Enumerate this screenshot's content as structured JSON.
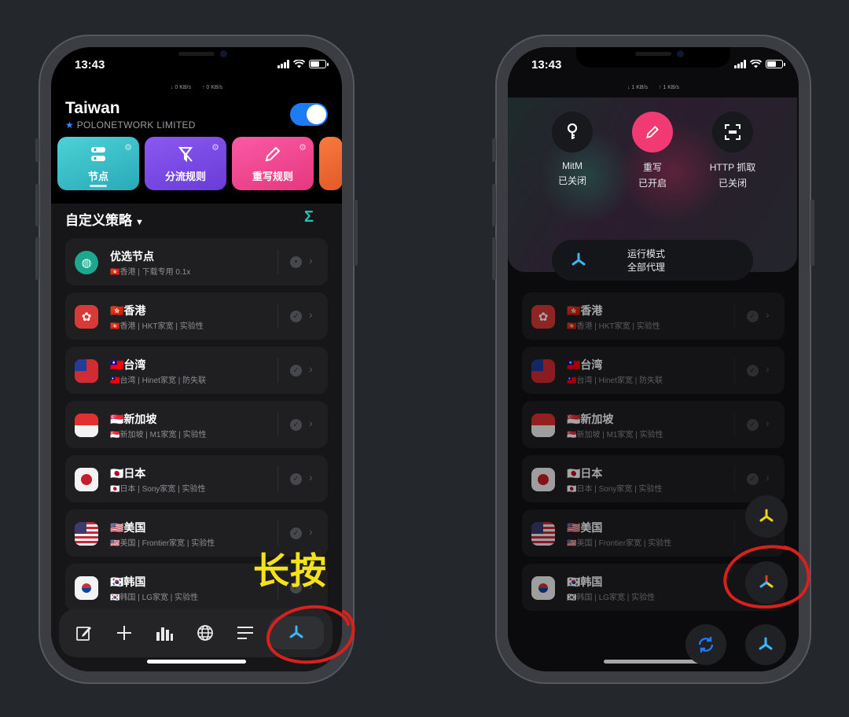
{
  "status": {
    "time": "13:43"
  },
  "left": {
    "speeds": {
      "down": "↓ 0 KB/s",
      "up": "↑ 0 KB/s"
    },
    "header": {
      "country": "Taiwan",
      "provider": "POLONETWORK LIMITED",
      "provider_icon": "star-icon",
      "vpn_on": true
    },
    "tiles": [
      {
        "label": "节点",
        "icon": "server-icon",
        "color": "#3cc0c8"
      },
      {
        "label": "分流规则",
        "icon": "split-icon",
        "color": "#7a4ae6"
      },
      {
        "label": "重写规则",
        "icon": "pencil-icon",
        "color": "#f04891"
      }
    ],
    "policy_title": "自定义策略",
    "nodes": [
      {
        "name": "优选节点",
        "sub": "🇭🇰香港 | 下载专用 0.1x"
      },
      {
        "name": "🇭🇰香港",
        "sub": "🇭🇰香港 | HKT家宽 | 实验性"
      },
      {
        "name": "🇹🇼台湾",
        "sub": "🇹🇼台湾 | Hinet家宽 | 防失联"
      },
      {
        "name": "🇸🇬新加坡",
        "sub": "🇸🇬新加坡 | M1家宽 | 实验性"
      },
      {
        "name": "🇯🇵日本",
        "sub": "🇯🇵日本 | Sony家宽 | 实验性"
      },
      {
        "name": "🇺🇸美国",
        "sub": "🇺🇸美国 | Frontier家宽 | 实验性"
      },
      {
        "name": "🇰🇷韩国",
        "sub": "🇰🇷韩国 | LG家宽 | 实验性"
      }
    ],
    "tabbar": [
      "edit-icon",
      "plus-icon",
      "stats-icon",
      "globe-icon",
      "menu-icon",
      "fan-icon"
    ],
    "annotation": "长按"
  },
  "right": {
    "speeds": {
      "down": "↓ 1 KB/s",
      "up": "↑ 1 KB/s"
    },
    "controls": [
      {
        "name": "MitM",
        "state": "已关闭",
        "icon": "key-icon"
      },
      {
        "name": "重写",
        "state": "已开启",
        "icon": "pencil-icon"
      },
      {
        "name": "HTTP 抓取",
        "state": "已关闭",
        "icon": "http-capture-icon"
      }
    ],
    "mode": {
      "label": "运行模式",
      "value": "全部代理"
    }
  },
  "colors": {
    "accent": "#1e7cf2",
    "annotation": "#f5e21b",
    "circle": "#d8201d"
  }
}
